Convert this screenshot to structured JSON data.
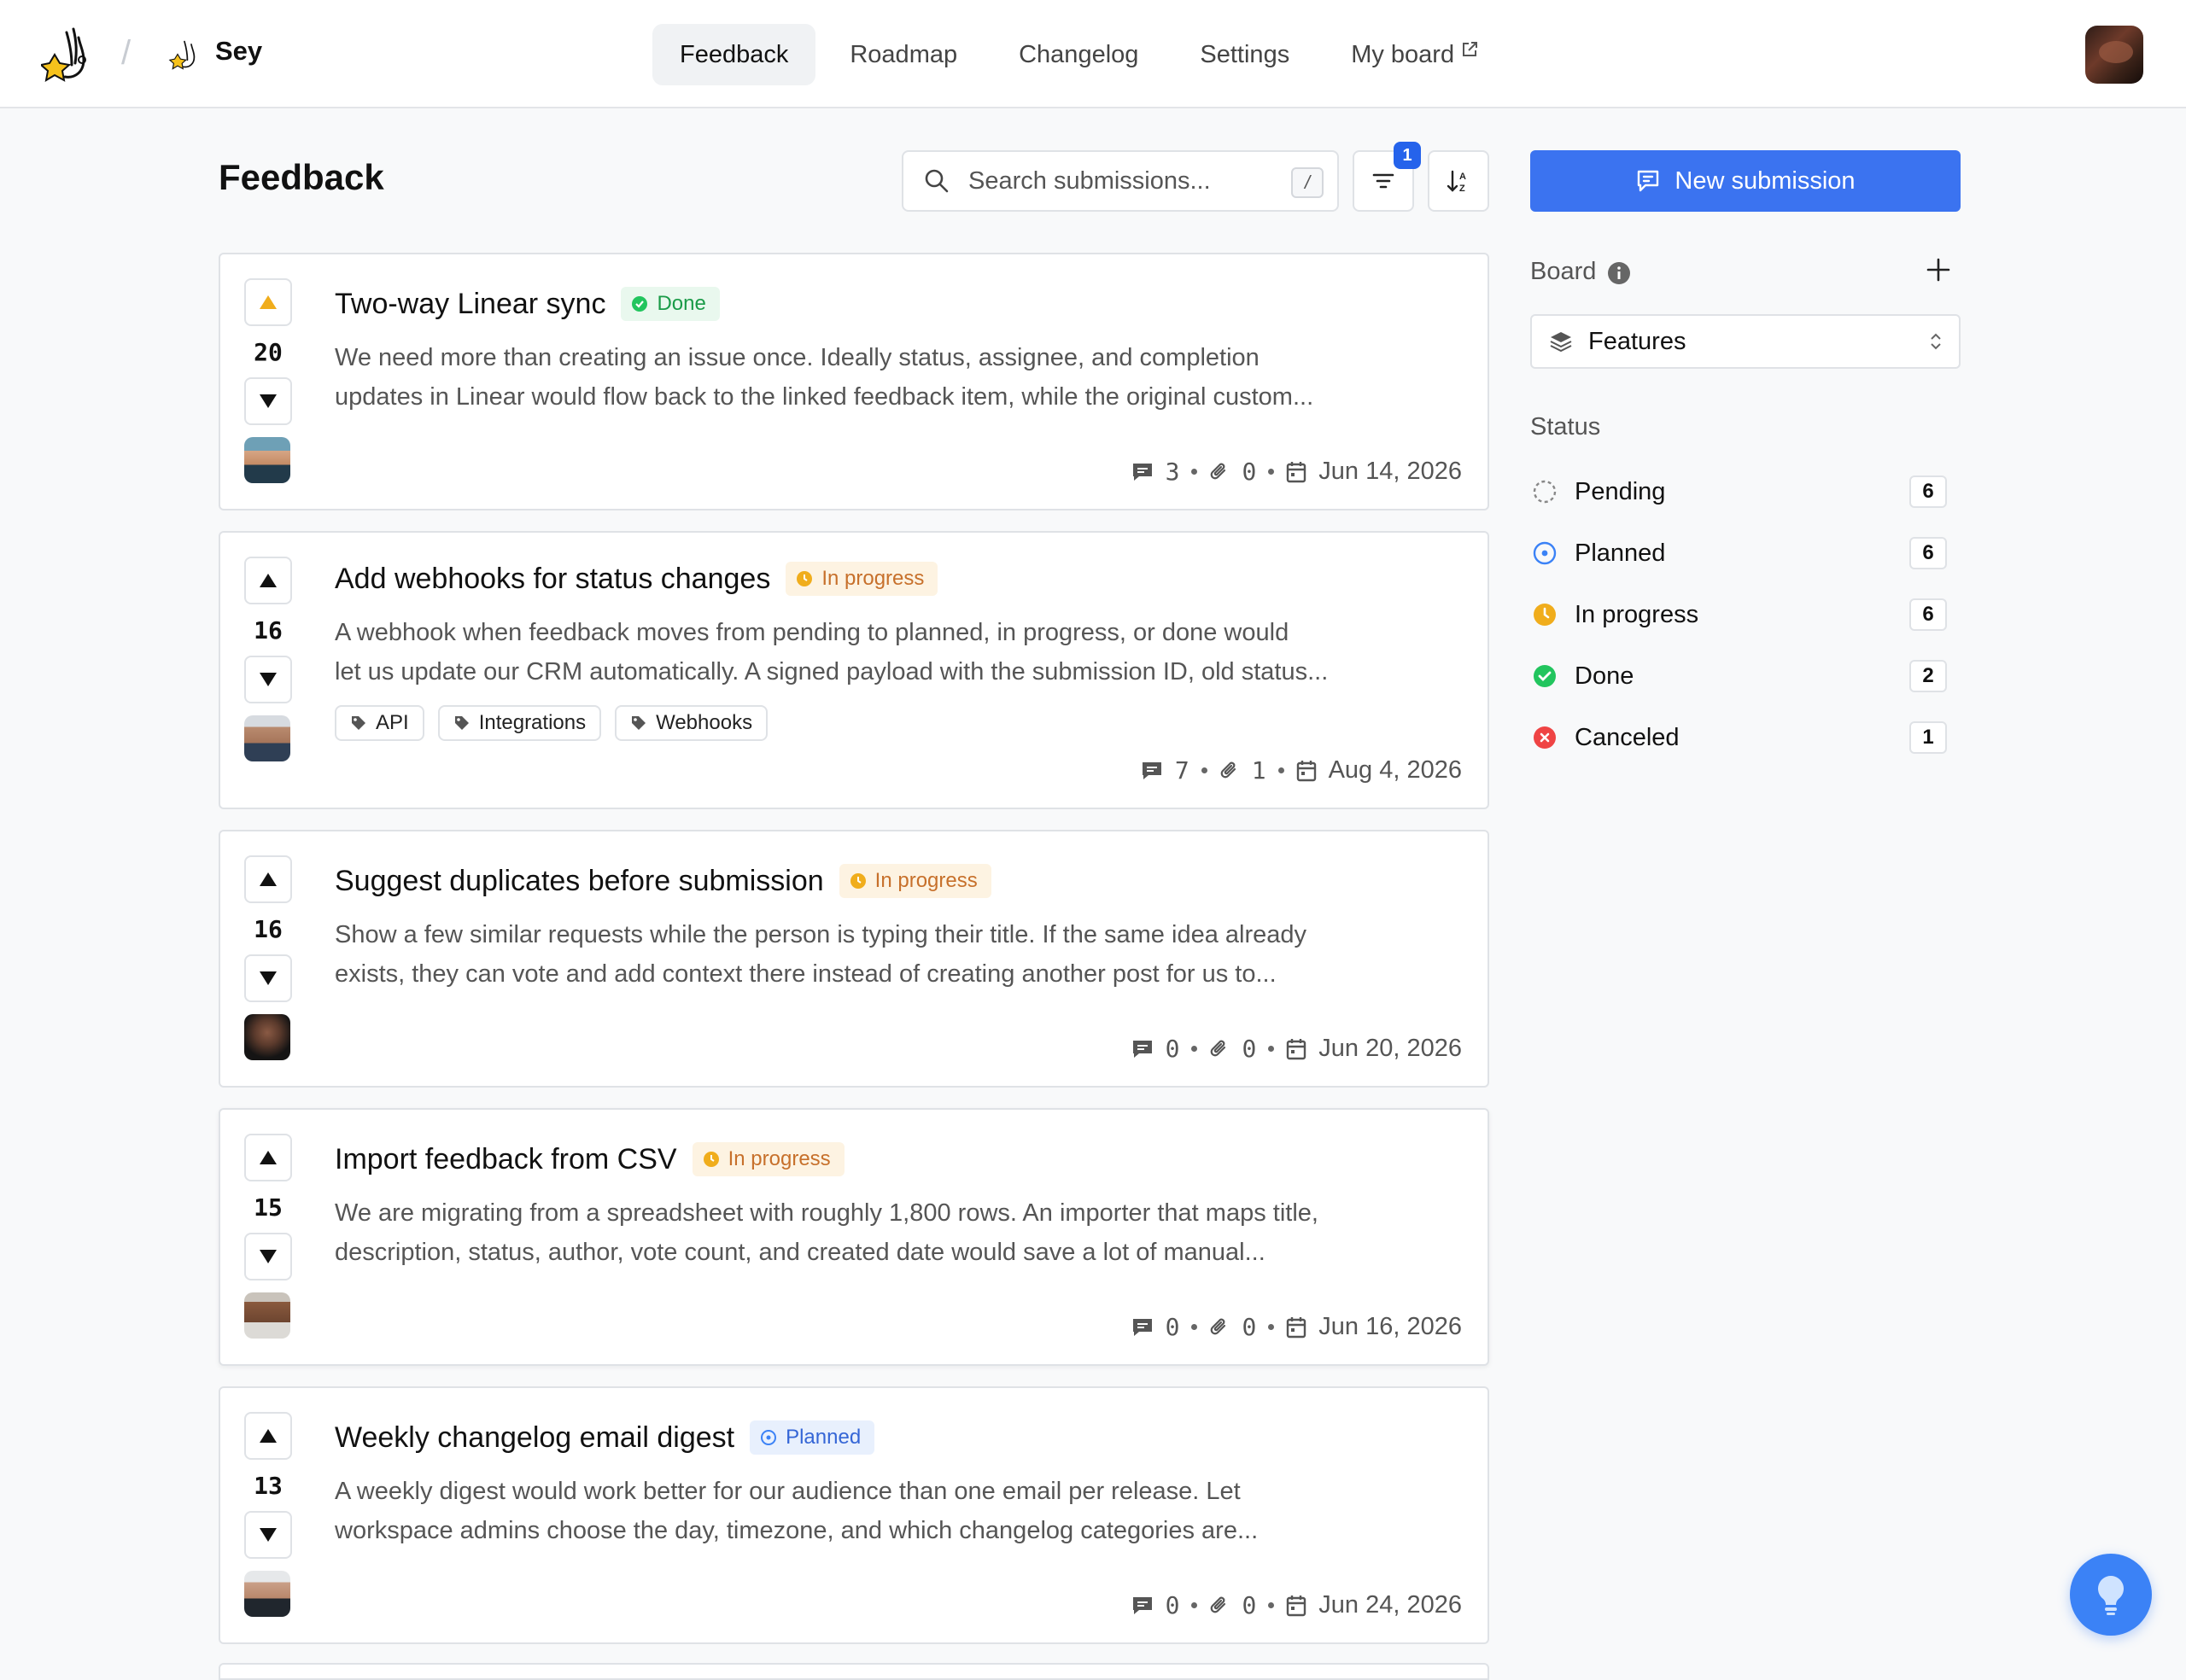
{
  "workspace": {
    "name": "Sey"
  },
  "nav": [
    {
      "label": "Feedback",
      "active": true
    },
    {
      "label": "Roadmap"
    },
    {
      "label": "Changelog"
    },
    {
      "label": "Settings"
    },
    {
      "label": "My board",
      "external": true
    }
  ],
  "page": {
    "title": "Feedback"
  },
  "search": {
    "placeholder": "Search submissions...",
    "shortcut": "/"
  },
  "filter": {
    "badge": "1"
  },
  "new_submission_label": "New submission",
  "sidebar": {
    "board_label": "Board",
    "board_value": "Features",
    "status_label": "Status",
    "statuses": [
      {
        "label": "Pending",
        "count": "6",
        "color": "#9aa0a6"
      },
      {
        "label": "Planned",
        "count": "6",
        "color": "#3b82f6"
      },
      {
        "label": "In progress",
        "count": "6",
        "color": "#f0ad1c"
      },
      {
        "label": "Done",
        "count": "2",
        "color": "#22c55e"
      },
      {
        "label": "Canceled",
        "count": "1",
        "color": "#ef4444"
      }
    ]
  },
  "submissions": [
    {
      "votes": "20",
      "title": "Two-way Linear sync",
      "status": "Done",
      "description_1": "We need more than creating an issue once. Ideally status, assignee, and completion",
      "description_2": "updates in Linear would flow back to the linked feedback item, while the original custom...",
      "comments": "3",
      "attachments": "0",
      "date": "Jun 14, 2026",
      "upvoted": true
    },
    {
      "votes": "16",
      "title": "Add webhooks for status changes",
      "status": "In progress",
      "description_1": "A webhook when feedback moves from pending to planned, in progress, or done would",
      "description_2": "let us update our CRM automatically. A signed payload with the submission ID, old status...",
      "tags": [
        "API",
        "Integrations",
        "Webhooks"
      ],
      "comments": "7",
      "attachments": "1",
      "date": "Aug 4, 2026"
    },
    {
      "votes": "16",
      "title": "Suggest duplicates before submission",
      "status": "In progress",
      "description_1": "Show a few similar requests while the person is typing their title. If the same idea already",
      "description_2": "exists, they can vote and add context there instead of creating another post for us to...",
      "comments": "0",
      "attachments": "0",
      "date": "Jun 20, 2026"
    },
    {
      "votes": "15",
      "title": "Import feedback from CSV",
      "status": "In progress",
      "description_1": "We are migrating from a spreadsheet with roughly 1,800 rows. An importer that maps title,",
      "description_2": "description, status, author, vote count, and created date would save a lot of manual...",
      "comments": "0",
      "attachments": "0",
      "date": "Jun 16, 2026"
    },
    {
      "votes": "13",
      "title": "Weekly changelog email digest",
      "status": "Planned",
      "description_1": "A weekly digest would work better for our audience than one email per release. Let",
      "description_2": "workspace admins choose the day, timezone, and which changelog categories are...",
      "comments": "0",
      "attachments": "0",
      "date": "Jun 24, 2026"
    }
  ],
  "colors": {
    "accent": "#3b73f0",
    "done": "#22c55e",
    "in_progress": "#f0ad1c",
    "planned": "#3b82f6"
  }
}
